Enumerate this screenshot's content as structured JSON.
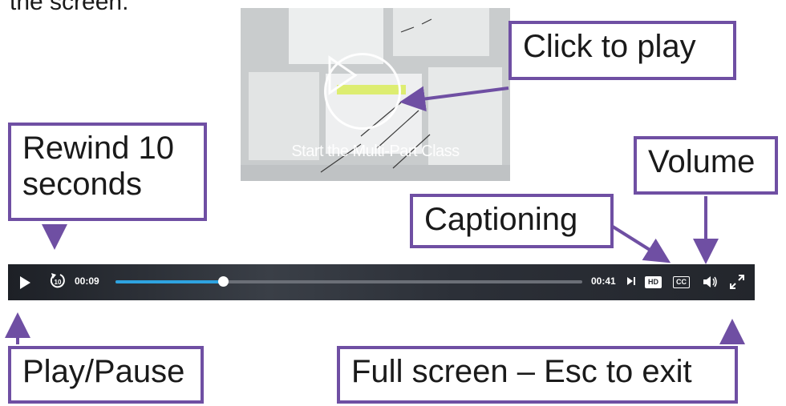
{
  "intro": {
    "text": "the screen."
  },
  "video": {
    "thumbnail_caption": "Start the Multi-Part Class"
  },
  "player": {
    "current_time": "00:09",
    "duration": "00:41",
    "progress": 0.23,
    "hd_label": "HD",
    "cc_label": "CC",
    "accent_color": "#2ea3e0"
  },
  "callouts": {
    "click_to_play": "Click to play",
    "rewind_line1": "Rewind 10",
    "rewind_line2": "seconds",
    "volume": "Volume",
    "captioning": "Captioning",
    "play_pause": "Play/Pause",
    "fullscreen": "Full screen – Esc to exit"
  },
  "colors": {
    "callout_border": "#6f4fa3",
    "arrow": "#6f4fa3"
  }
}
